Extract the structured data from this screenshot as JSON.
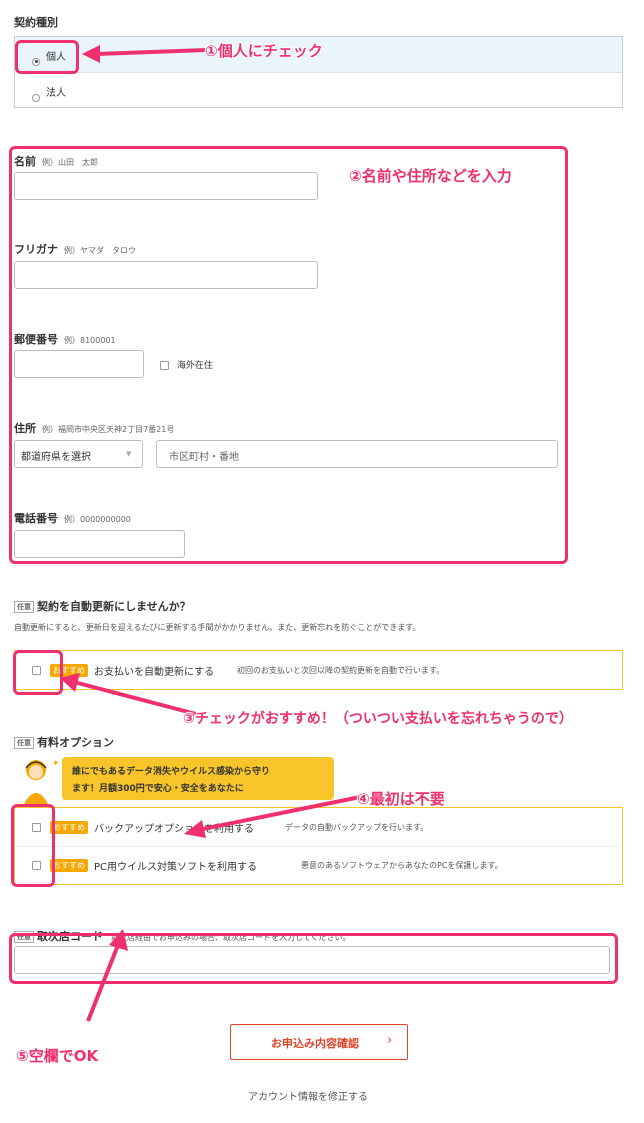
{
  "contract": {
    "title": "契約種別",
    "options": [
      "個人",
      "法人"
    ],
    "selected": "個人"
  },
  "name": {
    "label": "名前",
    "example": "例）山田　太郎"
  },
  "furigana": {
    "label": "フリガナ",
    "example": "例）ヤマダ　タロウ"
  },
  "postal": {
    "label": "郵便番号",
    "example": "例）8100001",
    "overseas_label": "海外在住"
  },
  "address": {
    "label": "住所",
    "example": "例）福岡市中央区天神2丁目7番21号",
    "prefecture_placeholder": "都道府県を選択",
    "city_placeholder": "市区町村・番地"
  },
  "phone": {
    "label": "電話番号",
    "example": "例）0000000000"
  },
  "auto_renew": {
    "tag": "任意",
    "title": "契約を自動更新にしませんか？",
    "description": "自動更新にすると、更新日を迎えるたびに更新する手間がかかりません。また、更新忘れを防ぐことができます。",
    "badge": "おすすめ",
    "option_label": "お支払いを自動更新にする",
    "option_note": "初回のお支払いと次回以降の契約更新を自動で行います。"
  },
  "paid_options": {
    "tag": "任意",
    "title": "有料オプション",
    "promo_line1": "誰にでもあるデータ消失やウイルス感染から守り",
    "promo_line2": "ます！月額300円で安心・安全をあなたに",
    "items": [
      {
        "badge": "おすすめ",
        "label": "バックアップオプションを利用する",
        "note": "データの自動バックアップを行います。"
      },
      {
        "badge": "おすすめ",
        "label": "PC用ウイルス対策ソフトを利用する",
        "note": "悪意のあるソフトウェアからあなたのPCを保護します。"
      }
    ]
  },
  "agency": {
    "tag": "任意",
    "title": "取次店コード",
    "note": "取次店経由でお申込みの場合、取次店コードを入力してください。"
  },
  "submit_label": "お申込み内容確認",
  "submit_arrow": "›",
  "edit_account_link": "アカウント情報を修正する",
  "annotations": {
    "a1": "①個人にチェック",
    "a2": "②名前や住所などを入力",
    "a3": "③チェックがおすすめ！（ついつい支払いを忘れちゃうので）",
    "a4": "④最初は不要",
    "a5": "⑤空欄でOK"
  },
  "colors": {
    "accent": "#f0306e",
    "badge": "#f6a800",
    "promo": "#f7c42a",
    "selected_bg": "#eaf4fb"
  }
}
